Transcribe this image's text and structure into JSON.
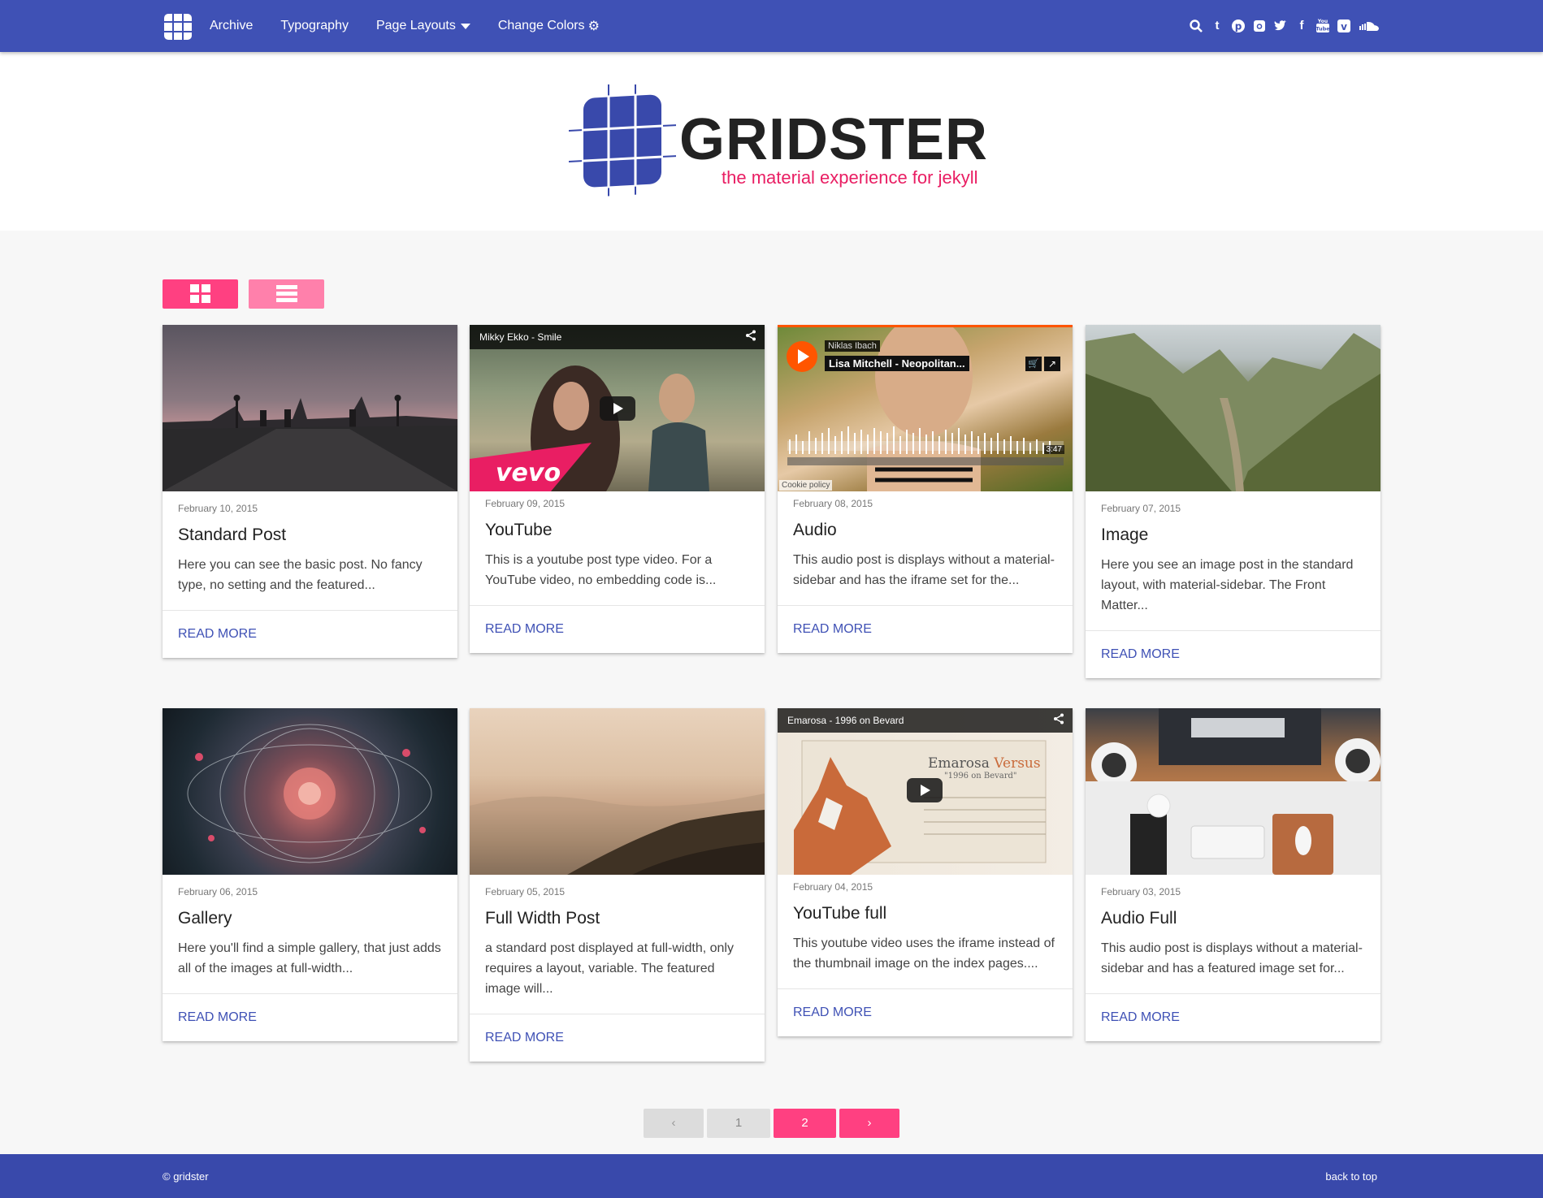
{
  "nav": {
    "links": [
      {
        "label": "Archive"
      },
      {
        "label": "Typography"
      },
      {
        "label": "Page Layouts"
      },
      {
        "label": "Change Colors"
      }
    ],
    "social_icons": [
      "search-icon",
      "tumblr-icon",
      "pinterest-icon",
      "instagram-icon",
      "twitter-icon",
      "facebook-icon",
      "youtube-icon",
      "vimeo-icon",
      "soundcloud-icon"
    ]
  },
  "brand": {
    "title": "GRIDSTER",
    "subtitle": "the material experience for jekyll"
  },
  "colors": {
    "primary": "#3f51b5",
    "footer": "#3949ab",
    "accent": "#ff4081",
    "accent_light": "#ff80ab",
    "subtitle": "#e91e63"
  },
  "posts": [
    {
      "date": "February 10, 2015",
      "title": "Standard Post",
      "excerpt": "Here you can see the basic post. No fancy type, no setting and the featured...",
      "action": "READ MORE"
    },
    {
      "date": "February 09, 2015",
      "title": "YouTube",
      "excerpt": "This is a youtube post type video. For a YouTube video, no embedding code is...",
      "action": "READ MORE",
      "video_title": "Mikky Ekko - Smile",
      "vevo": "vevo"
    },
    {
      "date": "February 08, 2015",
      "title": "Audio",
      "excerpt": "This audio post is displays without a material-sidebar and has the iframe set for the...",
      "action": "READ MORE",
      "artist": "Niklas Ibach",
      "track": "Lisa Mitchell - Neopolitan...",
      "duration": "3:47",
      "cookie": "Cookie policy"
    },
    {
      "date": "February 07, 2015",
      "title": "Image",
      "excerpt": "Here you see an image post in the standard layout, with material-sidebar. The Front Matter...",
      "action": "READ MORE"
    },
    {
      "date": "February 06, 2015",
      "title": "Gallery",
      "excerpt": "Here you'll find a simple gallery, that just adds all of the images at full-width...",
      "action": "READ MORE"
    },
    {
      "date": "February 05, 2015",
      "title": "Full Width Post",
      "excerpt": "a standard post displayed at full-width, only requires a layout, variable. The featured image will...",
      "action": "READ MORE"
    },
    {
      "date": "February 04, 2015",
      "title": "YouTube full",
      "excerpt": "This youtube video uses the iframe instead of the thumbnail image on the index pages....",
      "action": "READ MORE",
      "video_title": "Emarosa - 1996 on Bevard",
      "poster_title_a": "Emarosa",
      "poster_title_b": "Versus",
      "poster_sub": "\"1996 on Bevard\""
    },
    {
      "date": "February 03, 2015",
      "title": "Audio Full",
      "excerpt": "This audio post is displays without a material-sidebar and has a featured image set for...",
      "action": "READ MORE"
    }
  ],
  "pagination": {
    "prev": "‹",
    "pages": [
      "1",
      "2"
    ],
    "current": "2",
    "next": "›"
  },
  "footer": {
    "copyright": "© gridster",
    "back_to_top": "back to top"
  }
}
